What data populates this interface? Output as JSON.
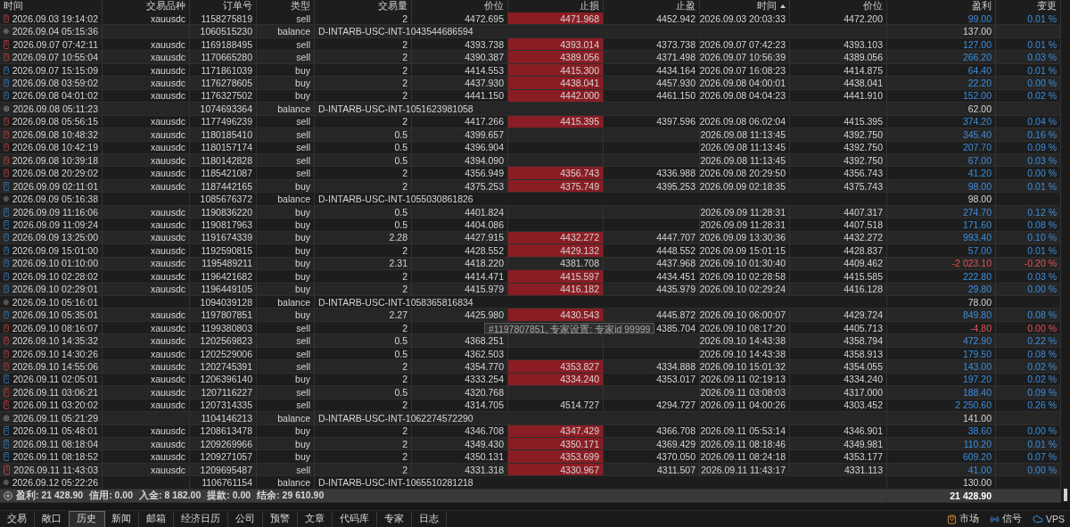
{
  "columns": [
    {
      "label": "时间",
      "sorted": false
    },
    {
      "label": "交易品种",
      "sorted": false
    },
    {
      "label": "订单号",
      "sorted": false
    },
    {
      "label": "类型",
      "sorted": false
    },
    {
      "label": "交易量",
      "sorted": false
    },
    {
      "label": "价位",
      "sorted": false
    },
    {
      "label": "止损",
      "sorted": false
    },
    {
      "label": "止盈",
      "sorted": false
    },
    {
      "label": "时间",
      "sorted": true
    },
    {
      "label": "价位",
      "sorted": false
    },
    {
      "label": "盈利",
      "sorted": false
    },
    {
      "label": "变更",
      "sorted": false
    }
  ],
  "rows": [
    {
      "kind": "sell",
      "time": "2026.09.03 19:14:02",
      "symbol": "xauusdc",
      "order": "1158275819",
      "type": "sell",
      "volume": "2",
      "price": "4472.695",
      "sl": "4471.968",
      "sl_hit": true,
      "tp": "4452.942",
      "close_time": "2026.09.03 20:03:33",
      "close_price": "4472.200",
      "profit": "99.00",
      "change": "0.01 %",
      "loss": false
    },
    {
      "kind": "balance",
      "time": "2026.09.04 05:15:36",
      "order": "1060515230",
      "type": "balance",
      "comment": "D-INTARB-USC-INT-1043544686594",
      "profit": "137.00"
    },
    {
      "kind": "sell",
      "time": "2026.09.07 07:42:11",
      "symbol": "xauusdc",
      "order": "1169188495",
      "type": "sell",
      "volume": "2",
      "price": "4393.738",
      "sl": "4393.014",
      "sl_hit": true,
      "tp": "4373.738",
      "close_time": "2026.09.07 07:42:23",
      "close_price": "4393.103",
      "profit": "127.00",
      "change": "0.01 %",
      "loss": false
    },
    {
      "kind": "sell",
      "time": "2026.09.07 10:55:04",
      "symbol": "xauusdc",
      "order": "1170665280",
      "type": "sell",
      "volume": "2",
      "price": "4390.387",
      "sl": "4389.056",
      "sl_hit": true,
      "tp": "4371.498",
      "close_time": "2026.09.07 10:56:39",
      "close_price": "4389.056",
      "profit": "266.20",
      "change": "0.03 %",
      "loss": false
    },
    {
      "kind": "buy",
      "time": "2026.09.07 15:15:09",
      "symbol": "xauusdc",
      "order": "1171861039",
      "type": "buy",
      "volume": "2",
      "price": "4414.553",
      "sl": "4415.300",
      "sl_hit": true,
      "tp": "4434.164",
      "close_time": "2026.09.07 16:08:23",
      "close_price": "4414.875",
      "profit": "64.40",
      "change": "0.01 %",
      "loss": false
    },
    {
      "kind": "buy",
      "time": "2026.09.08 03:59:02",
      "symbol": "xauusdc",
      "order": "1176278605",
      "type": "buy",
      "volume": "2",
      "price": "4437.930",
      "sl": "4438.041",
      "sl_hit": true,
      "tp": "4457.930",
      "close_time": "2026.09.08 04:00:01",
      "close_price": "4438.041",
      "profit": "22.20",
      "change": "0.00 %",
      "loss": false
    },
    {
      "kind": "buy",
      "time": "2026.09.08 04:01:02",
      "symbol": "xauusdc",
      "order": "1176327502",
      "type": "buy",
      "volume": "2",
      "price": "4441.150",
      "sl": "4442.000",
      "sl_hit": true,
      "tp": "4461.150",
      "close_time": "2026.09.08 04:04:23",
      "close_price": "4441.910",
      "profit": "152.00",
      "change": "0.02 %",
      "loss": false
    },
    {
      "kind": "balance",
      "time": "2026.09.08 05:11:23",
      "order": "1074693364",
      "type": "balance",
      "comment": "D-INTARB-USC-INT-1051623981058",
      "profit": "62.00"
    },
    {
      "kind": "sell",
      "time": "2026.09.08 05:56:15",
      "symbol": "xauusdc",
      "order": "1177496239",
      "type": "sell",
      "volume": "2",
      "price": "4417.266",
      "sl": "4415.395",
      "sl_hit": true,
      "tp": "4397.596",
      "close_time": "2026.09.08 06:02:04",
      "close_price": "4415.395",
      "profit": "374.20",
      "change": "0.04 %",
      "loss": false
    },
    {
      "kind": "sell",
      "time": "2026.09.08 10:48:32",
      "symbol": "xauusdc",
      "order": "1180185410",
      "type": "sell",
      "volume": "0.5",
      "price": "4399.657",
      "sl_hit": false,
      "close_time": "2026.09.08 11:13:45",
      "close_price": "4392.750",
      "profit": "345.40",
      "change": "0.16 %",
      "loss": false
    },
    {
      "kind": "sell",
      "time": "2026.09.08 10:42:19",
      "symbol": "xauusdc",
      "order": "1180157174",
      "type": "sell",
      "volume": "0.5",
      "price": "4396.904",
      "sl_hit": false,
      "close_time": "2026.09.08 11:13:45",
      "close_price": "4392.750",
      "profit": "207.70",
      "change": "0.09 %",
      "loss": false
    },
    {
      "kind": "sell",
      "time": "2026.09.08 10:39:18",
      "symbol": "xauusdc",
      "order": "1180142828",
      "type": "sell",
      "volume": "0.5",
      "price": "4394.090",
      "sl_hit": false,
      "close_time": "2026.09.08 11:13:45",
      "close_price": "4392.750",
      "profit": "67.00",
      "change": "0.03 %",
      "loss": false
    },
    {
      "kind": "sell",
      "time": "2026.09.08 20:29:02",
      "symbol": "xauusdc",
      "order": "1185421087",
      "type": "sell",
      "volume": "2",
      "price": "4356.949",
      "sl": "4356.743",
      "sl_hit": true,
      "tp": "4336.988",
      "close_time": "2026.09.08 20:29:50",
      "close_price": "4356.743",
      "profit": "41.20",
      "change": "0.00 %",
      "loss": false
    },
    {
      "kind": "buy",
      "time": "2026.09.09 02:11:01",
      "symbol": "xauusdc",
      "order": "1187442165",
      "type": "buy",
      "volume": "2",
      "price": "4375.253",
      "sl": "4375.749",
      "sl_hit": true,
      "tp": "4395.253",
      "close_time": "2026.09.09 02:18:35",
      "close_price": "4375.743",
      "profit": "98.00",
      "change": "0.01 %",
      "loss": false
    },
    {
      "kind": "balance",
      "time": "2026.09.09 05:16:38",
      "order": "1085676372",
      "type": "balance",
      "comment": "D-INTARB-USC-INT-1055030861826",
      "profit": "98.00"
    },
    {
      "kind": "buy",
      "time": "2026.09.09 11:16:06",
      "symbol": "xauusdc",
      "order": "1190836220",
      "type": "buy",
      "volume": "0.5",
      "price": "4401.824",
      "sl_hit": false,
      "close_time": "2026.09.09 11:28:31",
      "close_price": "4407.317",
      "profit": "274.70",
      "change": "0.12 %",
      "loss": false
    },
    {
      "kind": "buy",
      "time": "2026.09.09 11:09:24",
      "symbol": "xauusdc",
      "order": "1190817963",
      "type": "buy",
      "volume": "0.5",
      "price": "4404.086",
      "sl_hit": false,
      "close_time": "2026.09.09 11:28:31",
      "close_price": "4407.518",
      "profit": "171.60",
      "change": "0.08 %",
      "loss": false
    },
    {
      "kind": "buy",
      "time": "2026.09.09 13:25:00",
      "symbol": "xauusdc",
      "order": "1191674339",
      "type": "buy",
      "volume": "2.28",
      "price": "4427.915",
      "sl": "4432.272",
      "sl_hit": true,
      "tp": "4447.707",
      "close_time": "2026.09.09 13:30:36",
      "close_price": "4432.272",
      "profit": "993.40",
      "change": "0.10 %",
      "loss": false
    },
    {
      "kind": "buy",
      "time": "2026.09.09 15:01:00",
      "symbol": "xauusdc",
      "order": "1192590815",
      "type": "buy",
      "volume": "2",
      "price": "4428.552",
      "sl": "4429.132",
      "sl_hit": true,
      "tp": "4448.552",
      "close_time": "2026.09.09 15:01:15",
      "close_price": "4428.837",
      "profit": "57.00",
      "change": "0.01 %",
      "loss": false
    },
    {
      "kind": "buy",
      "time": "2026.09.10 01:10:00",
      "symbol": "xauusdc",
      "order": "1195489211",
      "type": "buy",
      "volume": "2.31",
      "price": "4418.220",
      "sl": "4381.708",
      "sl_hit": false,
      "tp": "4437.968",
      "close_time": "2026.09.10 01:30:40",
      "close_price": "4409.462",
      "profit": "-2 023.10",
      "change": "-0.20 %",
      "loss": true
    },
    {
      "kind": "buy",
      "time": "2026.09.10 02:28:02",
      "symbol": "xauusdc",
      "order": "1196421682",
      "type": "buy",
      "volume": "2",
      "price": "4414.471",
      "sl": "4415.597",
      "sl_hit": true,
      "tp": "4434.451",
      "close_time": "2026.09.10 02:28:58",
      "close_price": "4415.585",
      "profit": "222.80",
      "change": "0.03 %",
      "loss": false
    },
    {
      "kind": "buy",
      "time": "2026.09.10 02:29:01",
      "symbol": "xauusdc",
      "order": "1196449105",
      "type": "buy",
      "volume": "2",
      "price": "4415.979",
      "sl": "4416.182",
      "sl_hit": true,
      "tp": "4435.979",
      "close_time": "2026.09.10 02:29:24",
      "close_price": "4416.128",
      "profit": "29.80",
      "change": "0.00 %",
      "loss": false
    },
    {
      "kind": "balance",
      "time": "2026.09.10 05:16:01",
      "order": "1094039128",
      "type": "balance",
      "comment": "D-INTARB-USC-INT-1058365816834",
      "profit": "78.00"
    },
    {
      "kind": "buy",
      "time": "2026.09.10 05:35:01",
      "symbol": "xauusdc",
      "order": "1197807851",
      "type": "buy",
      "volume": "2.27",
      "price": "4425.980",
      "sl": "4430.543",
      "sl_hit": true,
      "tp": "4445.872",
      "close_time": "2026.09.10 06:00:07",
      "close_price": "4429.724",
      "profit": "849.80",
      "change": "0.08 %",
      "loss": false
    },
    {
      "kind": "sell",
      "time": "2026.09.10 08:16:07",
      "symbol": "xauusdc",
      "order": "1199380803",
      "type": "sell",
      "volume": "2",
      "sl_hit": false,
      "tp": "4385.704",
      "close_time": "2026.09.10 08:17:20",
      "close_price": "4405.713",
      "profit": "-4.80",
      "change": "0.00 %",
      "loss": true
    },
    {
      "kind": "sell",
      "time": "2026.09.10 14:35:32",
      "symbol": "xauusdc",
      "order": "1202569823",
      "type": "sell",
      "volume": "0.5",
      "price": "4368.251",
      "sl_hit": false,
      "close_time": "2026.09.10 14:43:38",
      "close_price": "4358.794",
      "profit": "472.90",
      "change": "0.22 %",
      "loss": false
    },
    {
      "kind": "sell",
      "time": "2026.09.10 14:30:26",
      "symbol": "xauusdc",
      "order": "1202529006",
      "type": "sell",
      "volume": "0.5",
      "price": "4362.503",
      "sl_hit": false,
      "close_time": "2026.09.10 14:43:38",
      "close_price": "4358.913",
      "profit": "179.50",
      "change": "0.08 %",
      "loss": false
    },
    {
      "kind": "sell",
      "time": "2026.09.10 14:55:06",
      "symbol": "xauusdc",
      "order": "1202745391",
      "type": "sell",
      "volume": "2",
      "price": "4354.770",
      "sl": "4353.827",
      "sl_hit": true,
      "tp": "4334.888",
      "close_time": "2026.09.10 15:01:32",
      "close_price": "4354.055",
      "profit": "143.00",
      "change": "0.02 %",
      "loss": false
    },
    {
      "kind": "buy",
      "time": "2026.09.11 02:05:01",
      "symbol": "xauusdc",
      "order": "1206396140",
      "type": "buy",
      "volume": "2",
      "price": "4333.254",
      "sl": "4334.240",
      "sl_hit": true,
      "tp": "4353.017",
      "close_time": "2026.09.11 02:19:13",
      "close_price": "4334.240",
      "profit": "197.20",
      "change": "0.02 %",
      "loss": false
    },
    {
      "kind": "sell",
      "time": "2026.09.11 03:06:21",
      "symbol": "xauusdc",
      "order": "1207116227",
      "type": "sell",
      "volume": "0.5",
      "price": "4320.768",
      "sl_hit": false,
      "close_time": "2026.09.11 03:08:03",
      "close_price": "4317.000",
      "profit": "188.40",
      "change": "0.09 %",
      "loss": false
    },
    {
      "kind": "sell",
      "time": "2026.09.11 03:20:02",
      "symbol": "xauusdc",
      "order": "1207314335",
      "type": "sell",
      "volume": "2",
      "price": "4314.705",
      "sl": "4514.727",
      "sl_hit": false,
      "tp": "4294.727",
      "close_time": "2026.09.11 04:00:26",
      "close_price": "4303.452",
      "profit": "2 250.60",
      "change": "0.26 %",
      "loss": false
    },
    {
      "kind": "balance",
      "time": "2026.09.11 05:21:29",
      "order": "1104146213",
      "type": "balance",
      "comment": "D-INTARB-USC-INT-1062274572290",
      "profit": "141.00"
    },
    {
      "kind": "buy",
      "time": "2026.09.11 05:48:01",
      "symbol": "xauusdc",
      "order": "1208613478",
      "type": "buy",
      "volume": "2",
      "price": "4346.708",
      "sl": "4347.429",
      "sl_hit": true,
      "tp": "4366.708",
      "close_time": "2026.09.11 05:53:14",
      "close_price": "4346.901",
      "profit": "38.60",
      "change": "0.00 %",
      "loss": false
    },
    {
      "kind": "buy",
      "time": "2026.09.11 08:18:04",
      "symbol": "xauusdc",
      "order": "1209269966",
      "type": "buy",
      "volume": "2",
      "price": "4349.430",
      "sl": "4350.171",
      "sl_hit": true,
      "tp": "4369.429",
      "close_time": "2026.09.11 08:18:46",
      "close_price": "4349.981",
      "profit": "110.20",
      "change": "0.01 %",
      "loss": false
    },
    {
      "kind": "buy",
      "time": "2026.09.11 08:18:52",
      "symbol": "xauusdc",
      "order": "1209271057",
      "type": "buy",
      "volume": "2",
      "price": "4350.131",
      "sl": "4353.699",
      "sl_hit": true,
      "tp": "4370.050",
      "close_time": "2026.09.11 08:24:18",
      "close_price": "4353.177",
      "profit": "609.20",
      "change": "0.07 %",
      "loss": false
    },
    {
      "kind": "sell",
      "time": "2026.09.11 11:43:03",
      "symbol": "xauusdc",
      "order": "1209695487",
      "type": "sell",
      "volume": "2",
      "price": "4331.318",
      "sl": "4330.967",
      "sl_hit": true,
      "tp": "4311.507",
      "close_time": "2026.09.11 11:43:17",
      "close_price": "4331.113",
      "profit": "41.00",
      "change": "0.00 %",
      "loss": false
    },
    {
      "kind": "balance",
      "time": "2026.09.12 05:22:26",
      "order": "1106761154",
      "type": "balance",
      "comment": "D-INTARB-USC-INT-1065510281218",
      "profit": "130.00"
    }
  ],
  "tooltip": "#1197807851, 专家设置: 专家id 99999",
  "summary": {
    "items": [
      "盈利: 21 428.90",
      "信用: 0.00",
      "入金: 8 182.00",
      "提款: 0.00",
      "结余: 29 610.90"
    ],
    "profit": "21 428.90"
  },
  "tabs": [
    {
      "label": "交易",
      "selected": false
    },
    {
      "label": "敞口",
      "selected": false
    },
    {
      "label": "历史",
      "selected": true
    },
    {
      "label": "新闻",
      "selected": false
    },
    {
      "label": "邮箱",
      "selected": false
    },
    {
      "label": "经济日历",
      "selected": false
    },
    {
      "label": "公司",
      "selected": false
    },
    {
      "label": "预警",
      "selected": false
    },
    {
      "label": "文章",
      "selected": false
    },
    {
      "label": "代码库",
      "selected": false
    },
    {
      "label": "专家",
      "selected": false
    },
    {
      "label": "日志",
      "selected": false
    }
  ],
  "status": [
    {
      "kind": "market",
      "label": "市场"
    },
    {
      "kind": "signals",
      "label": "信号"
    },
    {
      "kind": "vps",
      "label": "VPS"
    }
  ]
}
